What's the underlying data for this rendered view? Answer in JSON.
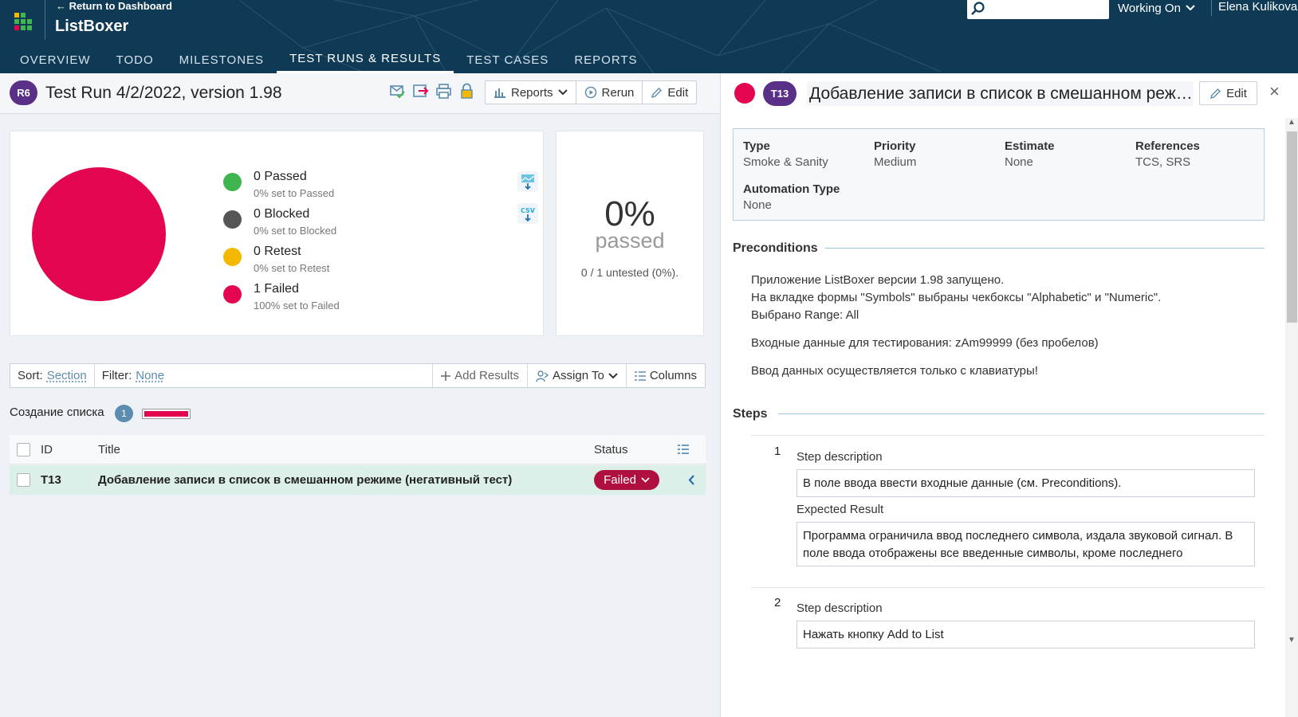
{
  "header": {
    "return_link": "← Return to Dashboard",
    "app_title": "ListBoxer",
    "search_value": "",
    "working_on": "Working On",
    "user": "Elena Kulikova"
  },
  "nav": {
    "tabs": [
      "OVERVIEW",
      "TODO",
      "MILESTONES",
      "TEST RUNS & RESULTS",
      "TEST CASES",
      "REPORTS"
    ],
    "active": "TEST RUNS & RESULTS"
  },
  "run": {
    "badge": "R6",
    "title": "Test Run 4/2/2022, version 1.98",
    "reports_label": "Reports",
    "rerun_label": "Rerun",
    "edit_label": "Edit"
  },
  "chart_data": {
    "type": "pie",
    "categories": [
      "Passed",
      "Blocked",
      "Retest",
      "Failed"
    ],
    "values": [
      0,
      0,
      0,
      1
    ],
    "colors": [
      "#3fb44f",
      "#555555",
      "#f5b800",
      "#e3054f"
    ],
    "legend": [
      {
        "label": "0 Passed",
        "sub": "0% set to Passed",
        "color": "#3fb44f"
      },
      {
        "label": "0 Blocked",
        "sub": "0% set to Blocked",
        "color": "#555555"
      },
      {
        "label": "0 Retest",
        "sub": "0% set to Retest",
        "color": "#f5b800"
      },
      {
        "label": "1 Failed",
        "sub": "100% set to Failed",
        "color": "#e3054f"
      }
    ]
  },
  "summary": {
    "percent": "0%",
    "percent_label": "passed",
    "untested": "0 / 1 untested (0%)."
  },
  "filterbar": {
    "sort_label": "Sort:",
    "sort_value": "Section",
    "filter_label": "Filter:",
    "filter_value": "None",
    "add_results": "Add Results",
    "assign_to": "Assign To",
    "columns": "Columns"
  },
  "section": {
    "title": "Создание списка",
    "count": "1"
  },
  "table": {
    "headers": {
      "id": "ID",
      "title": "Title",
      "status": "Status"
    },
    "rows": [
      {
        "id": "T13",
        "title": "Добавление записи в список в смешанном режиме (негативный тест)",
        "status": "Failed"
      }
    ]
  },
  "case": {
    "badge": "T13",
    "title": "Добавление записи в список в смешанном режиме (негативный тест)",
    "edit_label": "Edit",
    "props": [
      {
        "key": "Type",
        "value": "Smoke & Sanity"
      },
      {
        "key": "Priority",
        "value": "Medium"
      },
      {
        "key": "Estimate",
        "value": "None"
      },
      {
        "key": "References",
        "value": "TCS, SRS"
      },
      {
        "key": "Automation Type",
        "value": "None"
      }
    ],
    "preconditions_title": "Preconditions",
    "preconditions": [
      "Приложение ListBoxer версии 1.98 запущено.",
      "На вкладке формы \"Symbols\" выбраны чекбоксы \"Alphabetic\" и \"Numeric\".",
      "Выбрано Range: All",
      "Входные данные для тестирования: zAm99999 (без пробелов)",
      "Ввод данных осуществляется только с клавиатуры!"
    ],
    "steps_title": "Steps",
    "steps": [
      {
        "num": "1",
        "desc_label": "Step description",
        "desc": "В поле ввода ввести входные данные (см. Preconditions).",
        "exp_label": "Expected Result",
        "exp": "Программа ограничила ввод последнего символа, издала звуковой сигнал. В поле ввода отображены все введенные символы, кроме последнего"
      },
      {
        "num": "2",
        "desc_label": "Step description",
        "desc": "Нажать кнопку Add to List"
      }
    ]
  }
}
